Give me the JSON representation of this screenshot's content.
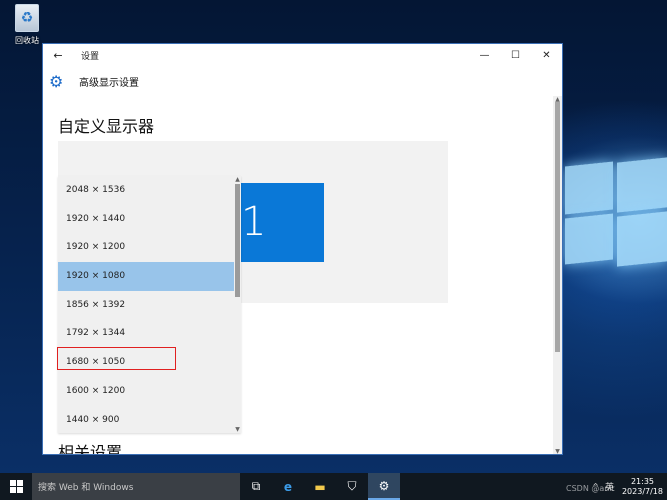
{
  "desktop": {
    "recycle_bin_label": "回收站"
  },
  "window": {
    "back_icon": "←",
    "title": "设置",
    "minimize_icon": "—",
    "maximize_icon": "☐",
    "close_icon": "✕",
    "header_title": "高级显示设置",
    "gear_icon": "⚙"
  },
  "page": {
    "heading": "自定义显示器",
    "related_heading": "相关设置",
    "monitor_number": "1",
    "resolutions": [
      "2048 × 1536",
      "1920 × 1440",
      "1920 × 1200",
      "1920 × 1080",
      "1856 × 1392",
      "1792 × 1344",
      "1680 × 1050",
      "1600 × 1200",
      "1440 × 900"
    ],
    "selected_resolution": "1920 × 1080",
    "accent_color": "#0a78d7",
    "selection_color": "#98c4ea",
    "highlight_color": "#e02020"
  },
  "taskbar": {
    "search_placeholder": "搜索 Web 和 Windows",
    "tray_lang": "英",
    "tray_up": "^",
    "time": "21:35",
    "date": "2023/7/18",
    "watermark": "CSDN @anlt"
  }
}
